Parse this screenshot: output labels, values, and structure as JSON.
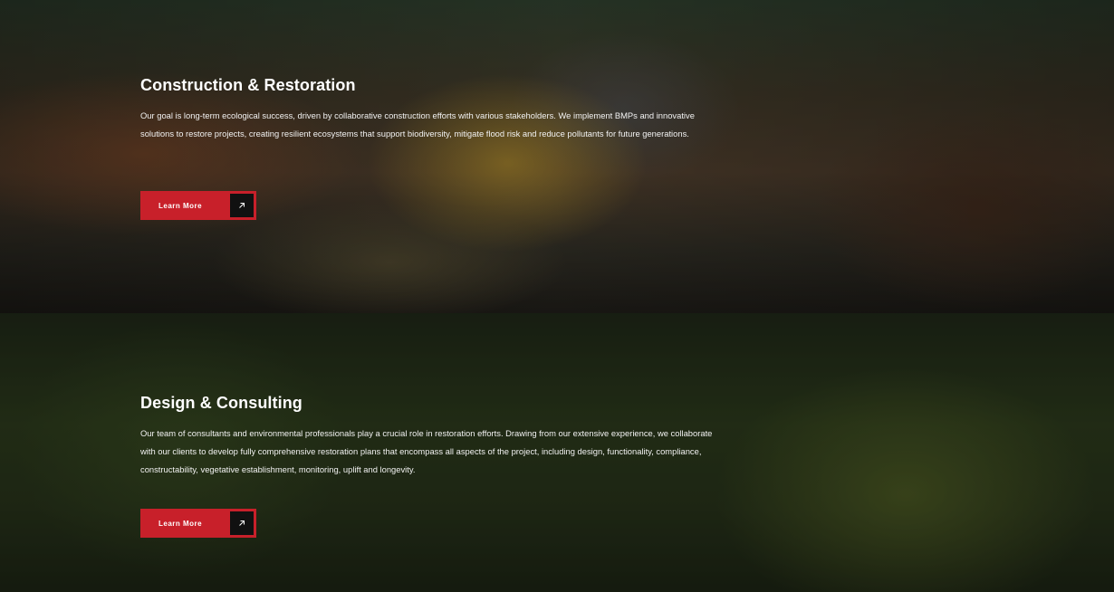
{
  "sections": [
    {
      "title": "Construction & Restoration",
      "body": "Our goal is long-term ecological success, driven by collaborative construction efforts with various stakeholders. We implement BMPs and innovative solutions to restore projects, creating resilient ecosystems that support biodiversity, mitigate flood risk and reduce pollutants for future generations.",
      "button_label": "Learn More",
      "button_icon": "arrow-up-right-icon",
      "background_image": "excavator-in-river-photo"
    },
    {
      "title": "Design & Consulting",
      "body": "Our team of consultants and environmental professionals play a crucial role in restoration efforts. Drawing from our extensive experience, we collaborate with our clients to develop fully comprehensive restoration plans that encompass all aspects of the project, including design, functionality, compliance, constructability, vegetative establishment, monitoring, uplift and longevity.",
      "button_label": "Learn More",
      "button_icon": "arrow-up-right-icon",
      "background_image": "consultant-taking-notes-photo"
    }
  ],
  "colors": {
    "accent": "#c8202a",
    "icon_box": "#111111",
    "text": "#ffffff"
  }
}
